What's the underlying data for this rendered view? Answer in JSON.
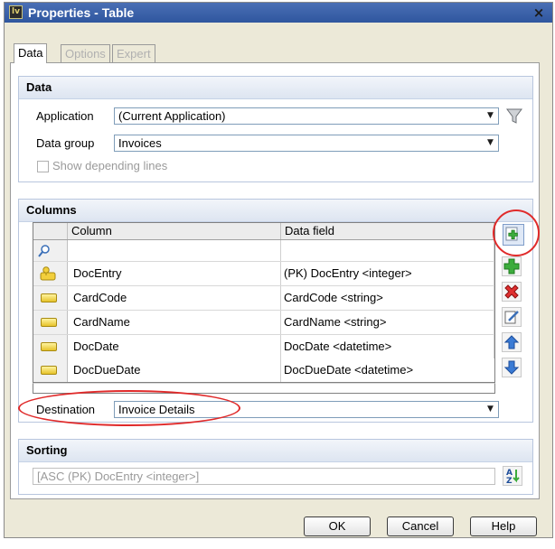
{
  "window": {
    "title": "Properties - Table",
    "close_glyph": "×"
  },
  "tabs": [
    {
      "label": "Data",
      "active": true
    },
    {
      "label": "Options",
      "active": false
    },
    {
      "label": "Expert",
      "active": false
    }
  ],
  "data_section": {
    "heading": "Data",
    "application_label": "Application",
    "application_value": "(Current Application)",
    "data_group_label": "Data group",
    "data_group_value": "Invoices",
    "show_depending_label": "Show depending lines"
  },
  "columns_section": {
    "heading": "Columns",
    "headers": [
      "Column",
      "Data field"
    ],
    "rows": [
      {
        "icon": "key-icon",
        "column": "DocEntry",
        "field": "(PK) DocEntry <integer>"
      },
      {
        "icon": "field-icon",
        "column": "CardCode",
        "field": "CardCode <string>"
      },
      {
        "icon": "field-icon",
        "column": "CardName",
        "field": "CardName <string>"
      },
      {
        "icon": "field-icon",
        "column": "DocDate",
        "field": "DocDate <datetime>"
      },
      {
        "icon": "field-icon",
        "column": "DocDueDate",
        "field": "DocDueDate <datetime>"
      }
    ],
    "destination_label": "Destination",
    "destination_value": "Invoice Details"
  },
  "sorting_section": {
    "heading": "Sorting",
    "value": "[ASC (PK) DocEntry <integer>]"
  },
  "buttons": {
    "ok": "OK",
    "cancel": "Cancel",
    "help": "Help"
  },
  "colors": {
    "title_bar": "#2f569f",
    "highlight_ellipse": "#e02a2a",
    "section_border": "#b8c6de"
  }
}
